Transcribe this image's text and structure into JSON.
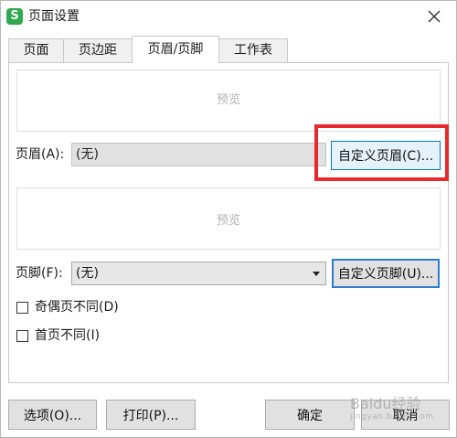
{
  "window": {
    "title": "页面设置",
    "app_icon_glyph": "S",
    "accent_color": "#2fa84f"
  },
  "tabs": [
    {
      "label": "页面",
      "active": false
    },
    {
      "label": "页边距",
      "active": false
    },
    {
      "label": "页眉/页脚",
      "active": true
    },
    {
      "label": "工作表",
      "active": false
    }
  ],
  "header": {
    "preview_text": "预览",
    "label": "页眉(A):",
    "value": "(无)",
    "custom_button": "自定义页眉(C)..."
  },
  "footer": {
    "preview_text": "预览",
    "label": "页脚(F):",
    "value": "(无)",
    "custom_button": "自定义页脚(U)..."
  },
  "options": {
    "odd_even": {
      "label": "奇偶页不同(D)",
      "checked": false
    },
    "first_page": {
      "label": "首页不同(I)",
      "checked": false
    }
  },
  "buttons": {
    "options": "选项(O)...",
    "print": "打印(P)...",
    "ok": "确定",
    "cancel": "取消"
  },
  "annotation": {
    "highlight_color": "#e8282b"
  },
  "watermark": {
    "text": "Baidu经验",
    "sub": "jingyan.baidu.com"
  },
  "icons": {
    "close": "close-icon",
    "dropdown": "chevron-down-icon"
  }
}
